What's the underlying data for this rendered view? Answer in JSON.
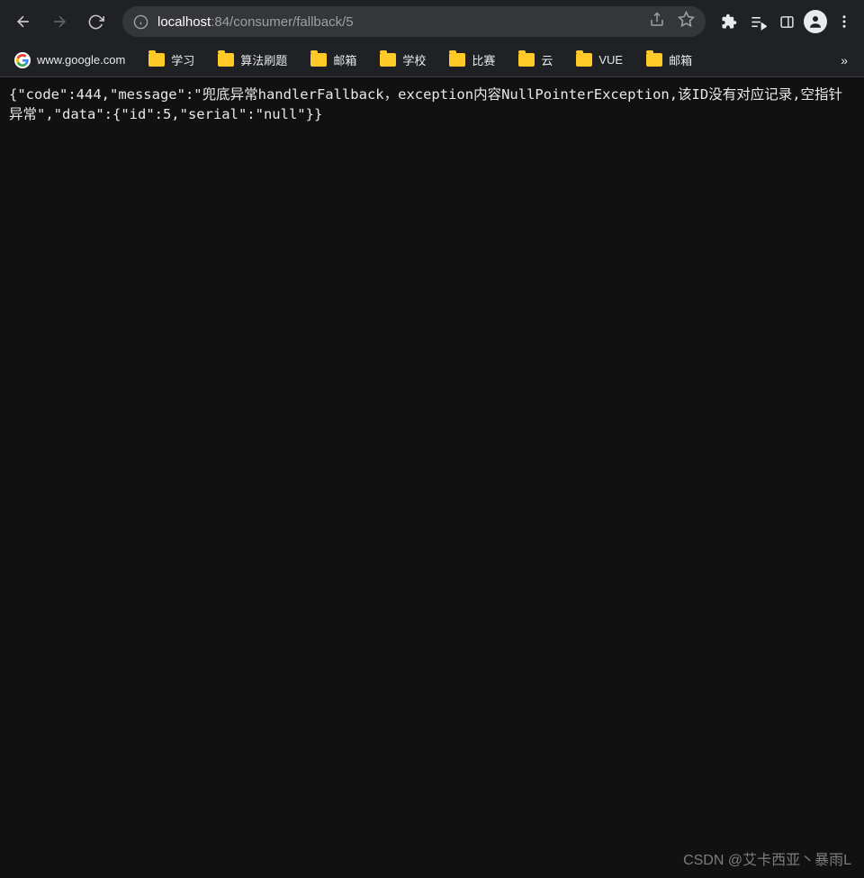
{
  "toolbar": {
    "url_host": "localhost",
    "url_rest": ":84/consumer/fallback/5"
  },
  "bookmarks": [
    {
      "label": "www.google.com",
      "icon": "google"
    },
    {
      "label": "学习",
      "icon": "folder"
    },
    {
      "label": "算法刷题",
      "icon": "folder"
    },
    {
      "label": "邮箱",
      "icon": "folder"
    },
    {
      "label": "学校",
      "icon": "folder"
    },
    {
      "label": "比赛",
      "icon": "folder"
    },
    {
      "label": "云",
      "icon": "folder"
    },
    {
      "label": "VUE",
      "icon": "folder"
    },
    {
      "label": "邮箱",
      "icon": "folder"
    }
  ],
  "overflow_chevron": "»",
  "page_body": "{\"code\":444,\"message\":\"兜底异常handlerFallback，exception内容NullPointerException,该ID没有对应记录,空指针异常\",\"data\":{\"id\":5,\"serial\":\"null\"}}",
  "watermark": "CSDN @艾卡西亚丶暴雨L"
}
